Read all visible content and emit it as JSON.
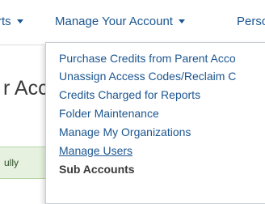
{
  "navbar": {
    "items": [
      {
        "label": "rts"
      },
      {
        "label": "Manage Your Account"
      },
      {
        "label": "Perso"
      }
    ]
  },
  "page": {
    "title": "r Acc"
  },
  "alert": {
    "text": "ully"
  },
  "dropdown": {
    "items": [
      {
        "label": "Purchase Credits from Parent Acco"
      },
      {
        "label": "Unassign Access Codes/Reclaim C"
      },
      {
        "label": "Credits Charged for Reports"
      },
      {
        "label": "Folder Maintenance"
      },
      {
        "label": "Manage My Organizations"
      },
      {
        "label": "Manage Users"
      },
      {
        "label": "Sub Accounts"
      }
    ]
  },
  "colors": {
    "link": "#1c5690",
    "text": "#3a3a3a",
    "alert_bg": "#e6f2df",
    "alert_border": "#b7d7a8"
  }
}
